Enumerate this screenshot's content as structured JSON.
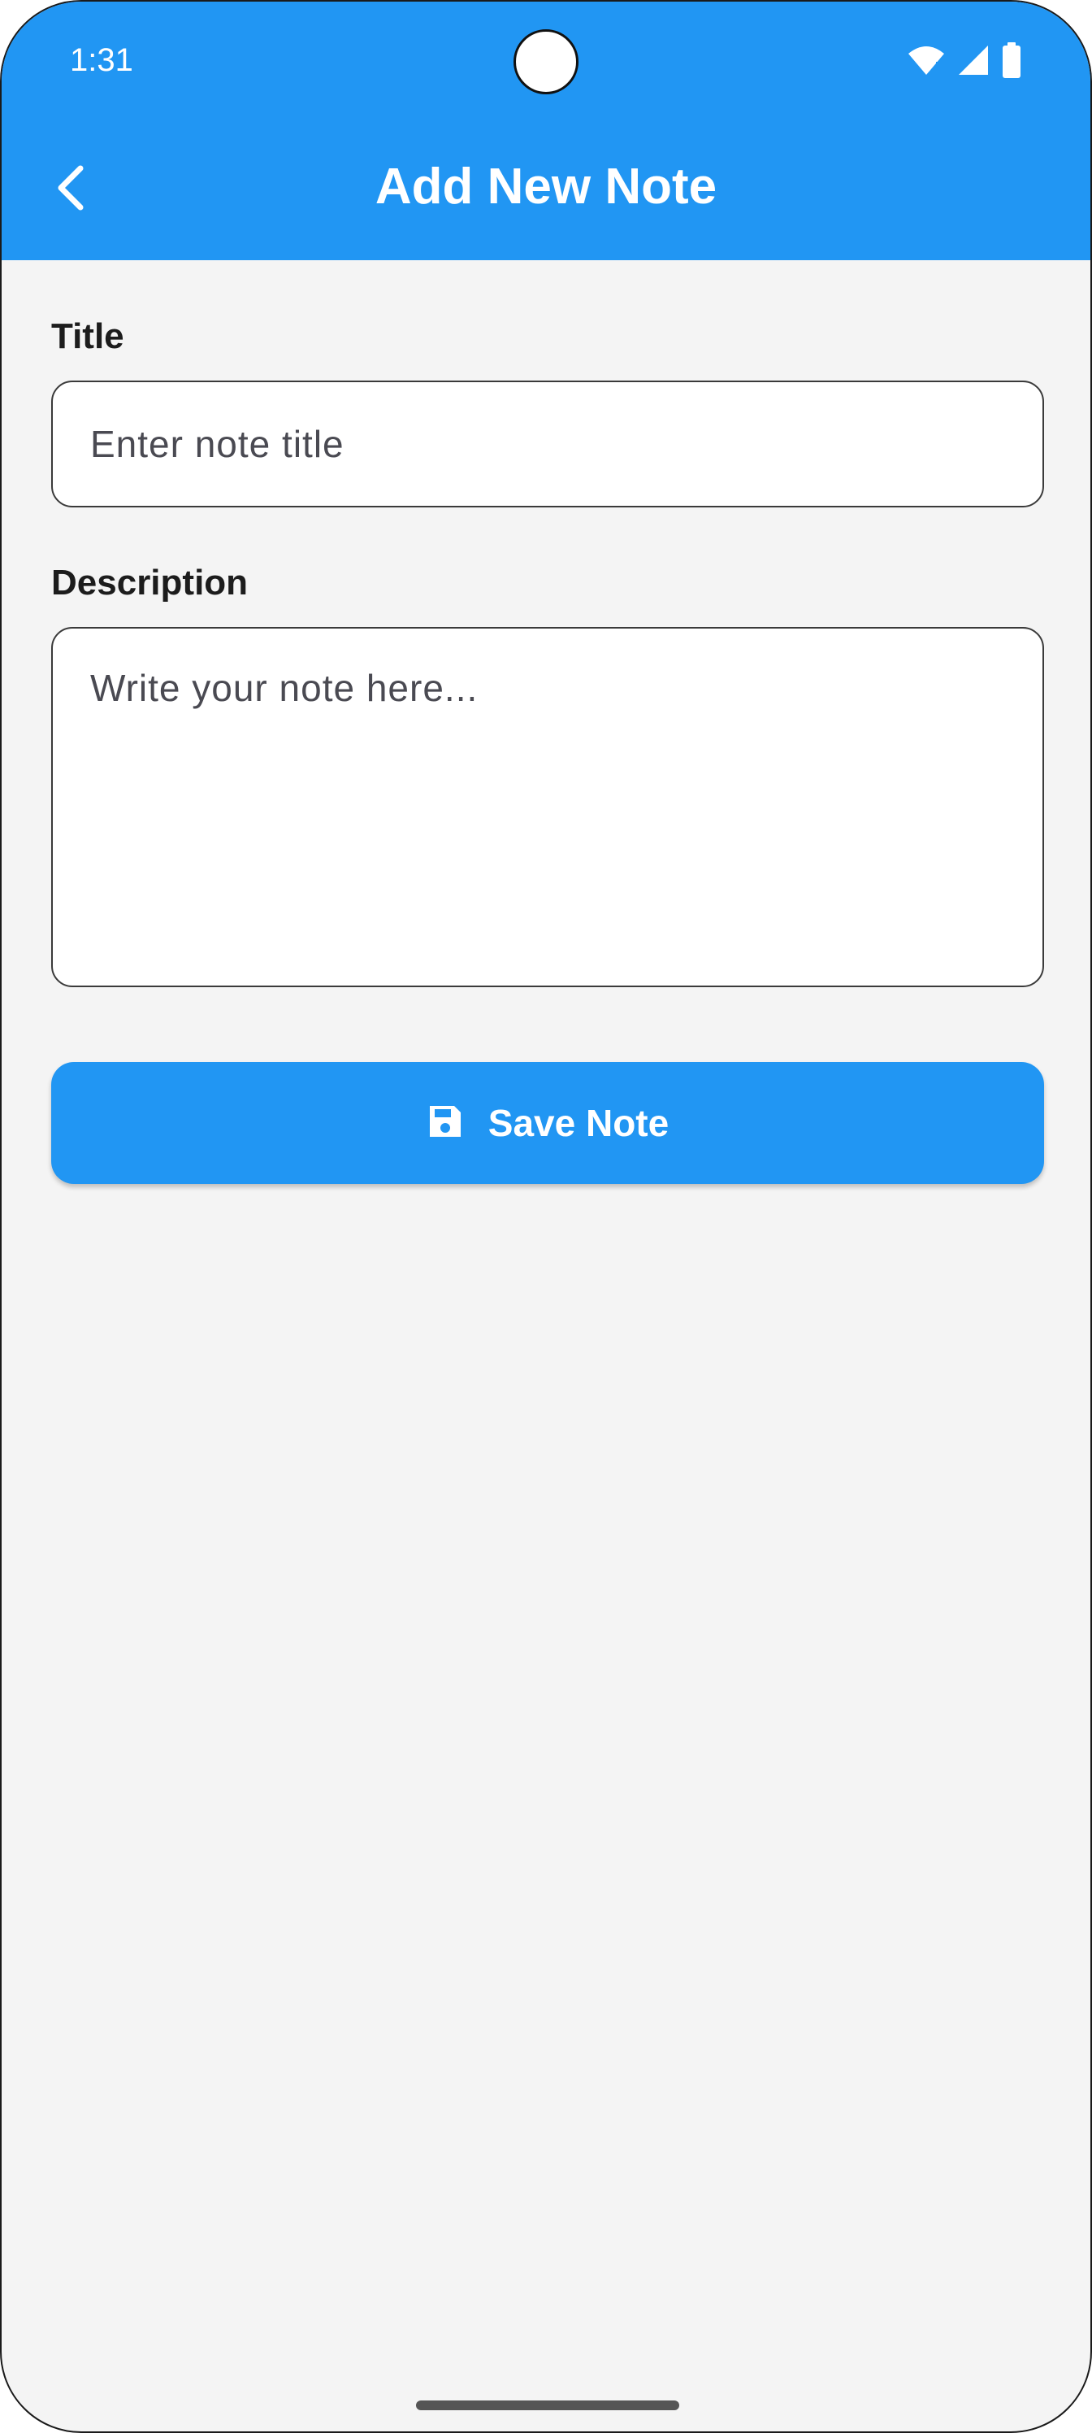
{
  "status_bar": {
    "time": "1:31",
    "icons": [
      "wifi-icon",
      "signal-icon",
      "battery-icon"
    ]
  },
  "app_bar": {
    "title": "Add New Note",
    "back_icon": "chevron-left-icon",
    "color": "#2196f3"
  },
  "form": {
    "title_field": {
      "label": "Title",
      "placeholder": "Enter note title",
      "value": ""
    },
    "description_field": {
      "label": "Description",
      "placeholder": "Write your note here...",
      "value": ""
    },
    "save_button": {
      "label": "Save Note",
      "icon": "save-icon"
    }
  },
  "colors": {
    "accent": "#2196f3",
    "background": "#f4f4f4",
    "text": "#1c1c1c"
  }
}
